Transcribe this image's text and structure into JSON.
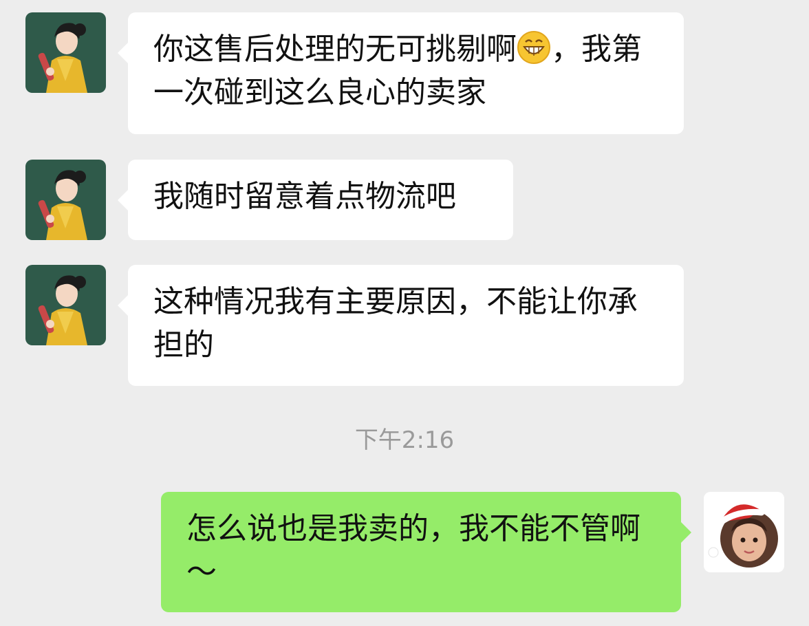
{
  "chat": {
    "messages": [
      {
        "sender": "other",
        "text_before_emoji": "你这售后处理的无可挑剔啊",
        "emoji": "grinning-face-emoji",
        "text_after_emoji": "，我第一次碰到这么良心的卖家"
      },
      {
        "sender": "other",
        "text": "我随时留意着点物流吧"
      },
      {
        "sender": "other",
        "text": "这种情况我有主要原因，不能让你承担的"
      },
      {
        "sender": "self",
        "text": "怎么说也是我卖的，我不能不管啊～"
      }
    ],
    "timestamp": "下午2:16"
  },
  "colors": {
    "background": "#ededed",
    "incoming_bubble": "#ffffff",
    "outgoing_bubble": "#95ec69",
    "timestamp_text": "#9a9a9a",
    "contact_avatar_bg": "#2f5a4a",
    "dress_yellow": "#e7b72c"
  }
}
